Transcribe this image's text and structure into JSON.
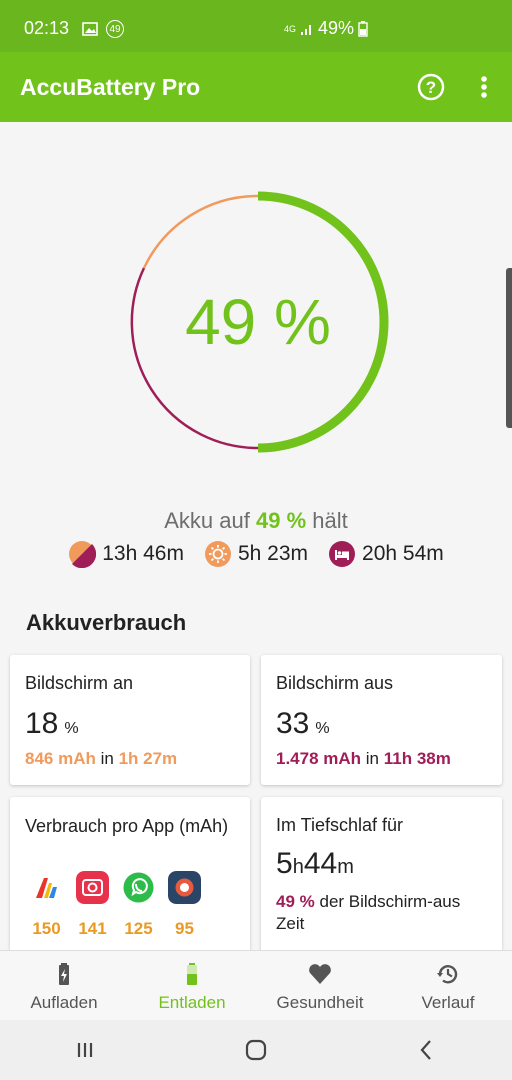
{
  "status_bar": {
    "time": "02:13",
    "notif_count": "49",
    "network": "4G",
    "battery": "49%"
  },
  "app_bar": {
    "title": "AccuBattery Pro"
  },
  "gauge": {
    "percent_label": "49 %",
    "level": 0.49
  },
  "holds": {
    "prefix": "Akku auf",
    "value": "49 %",
    "suffix": "hält",
    "mixed": "13h 46m",
    "screen_on": "5h 23m",
    "sleep": "20h 54m"
  },
  "section": {
    "title": "Akkuverbrauch"
  },
  "cards": {
    "screen_on": {
      "title": "Bildschirm an",
      "value": "18",
      "unit": "%",
      "mah": "846 mAh",
      "in": "in",
      "duration": "1h 27m"
    },
    "screen_off": {
      "title": "Bildschirm aus",
      "value": "33",
      "unit": "%",
      "mah": "1.478 mAh",
      "in": "in",
      "duration": "11h 38m"
    },
    "per_app": {
      "title": "Verbrauch pro App (mAh)",
      "apps": [
        {
          "value": "150"
        },
        {
          "value": "141"
        },
        {
          "value": "125"
        },
        {
          "value": "95"
        }
      ]
    },
    "deep_sleep": {
      "title": "Im Tiefschlaf für",
      "hours": "5",
      "h_unit": "h",
      "minutes": "44",
      "m_unit": "m",
      "pct": "49 %",
      "desc": "der Bildschirm-aus Zeit"
    }
  },
  "nav": [
    {
      "label": "Aufladen"
    },
    {
      "label": "Entladen"
    },
    {
      "label": "Gesundheit"
    },
    {
      "label": "Verlauf"
    }
  ],
  "colors": {
    "green": "#72c21c",
    "orange": "#f09a5c",
    "purple": "#a01e58"
  }
}
